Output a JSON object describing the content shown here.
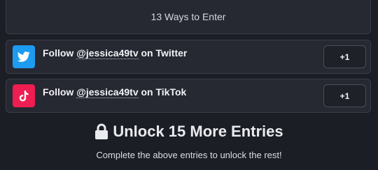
{
  "header": {
    "title": "13 Ways to Enter"
  },
  "entries": [
    {
      "platform_icon": "twitter-bird-icon",
      "prefix": "Follow",
      "handle": "@jessica49tv",
      "suffix": "on Twitter",
      "action_label": "+1",
      "color": "#1d9bf0"
    },
    {
      "platform_icon": "tiktok-note-icon",
      "prefix": "Follow",
      "handle": "@jessica49tv",
      "suffix": "on TikTok",
      "action_label": "+1",
      "color": "#ee1d52"
    }
  ],
  "unlock": {
    "icon": "lock-icon",
    "title": "Unlock 15 More Entries",
    "subtitle": "Complete the above entries to unlock the rest!"
  }
}
